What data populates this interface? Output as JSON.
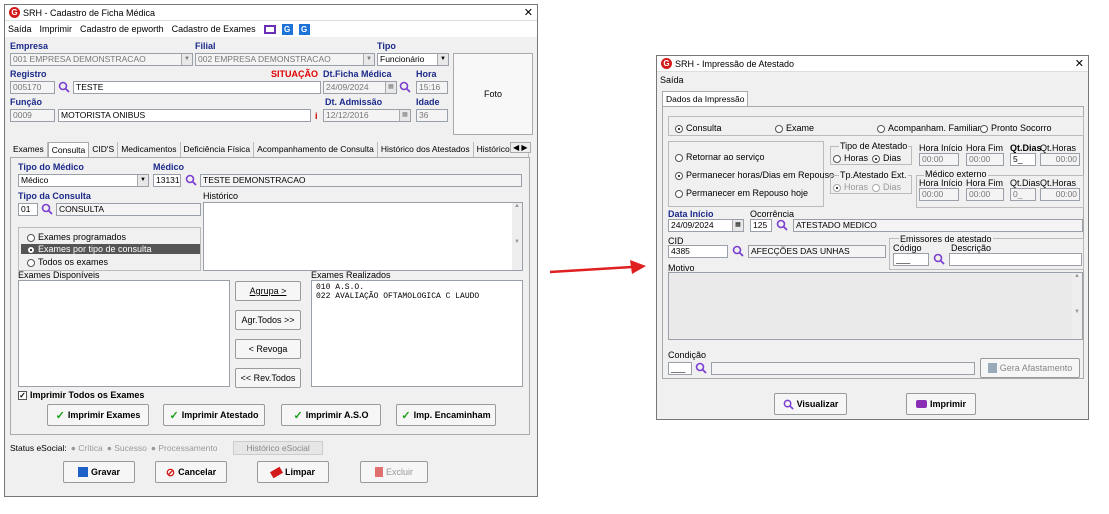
{
  "left_window": {
    "title": "SRH - Cadastro de Ficha Médica",
    "menu": [
      "Saída",
      "Imprimir",
      "Cadastro de epworth",
      "Cadastro de Exames"
    ],
    "empresa_label": "Empresa",
    "empresa_value": "001 EMPRESA DEMONSTRACAO",
    "filial_label": "Filial",
    "filial_value": "002 EMPRESA DEMONSTRACAO",
    "tipo_label": "Tipo",
    "tipo_value": "Funcionário",
    "registro_label": "Registro",
    "registro_code": "005170",
    "registro_name": "TESTE",
    "situacao_label": "SITUAÇÃO",
    "dt_ficha_label": "Dt.Ficha Médica",
    "dt_ficha_value": "24/09/2024",
    "hora_label": "Hora",
    "hora_value": "15:16",
    "foto_label": "Foto",
    "funcao_label": "Função",
    "funcao_code": "0009",
    "funcao_name": "MOTORISTA ONIBUS",
    "dt_admissao_label": "Dt. Admissão",
    "dt_admissao_value": "12/12/2016",
    "idade_label": "Idade",
    "idade_value": "36",
    "tabs": [
      "Exames",
      "Consulta",
      "CID'S",
      "Medicamentos",
      "Deficiência Física",
      "Acompanhamento de Consulta",
      "Histórico dos Atestados",
      "Histórico A.S"
    ],
    "tipo_medico_label": "Tipo do Médico",
    "tipo_medico_value": "Médico",
    "medico_label": "Médico",
    "medico_code": "13131",
    "medico_name": "TESTE DEMONSTRACAO",
    "tipo_consulta_label": "Tipo da Consulta",
    "tipo_consulta_code": "01",
    "tipo_consulta_name": "CONSULTA",
    "historico_label": "Histórico",
    "radio_options": [
      "Exames programados",
      "Exames por tipo de consulta",
      "Todos os exames"
    ],
    "exames_disponiveis_label": "Exames Disponíveis",
    "exames_realizados_label": "Exames Realizados",
    "exames_realizados": [
      "010 A.S.O.",
      "022 AVALIAÇÃO OFTAMOLOGICA C LAUDO"
    ],
    "btn_agrupa": "Agrupa >",
    "btn_agr_todos": "Agr.Todos >>",
    "btn_revoga": "< Revoga",
    "btn_rev_todos": "<< Rev.Todos",
    "imprimir_todos_label": "Imprimir Todos os Exames",
    "btn_imprimir_exames": "Imprimir Exames",
    "btn_imprimir_atestado": "Imprimir Atestado",
    "btn_imprimir_aso": "Imprimir A.S.O",
    "btn_imp_encaminham": "Imp. Encaminham",
    "status_label": "Status eSocial:",
    "status_critica": "Crítica",
    "status_sucesso": "Sucesso",
    "status_processamento": "Processamento",
    "historico_esocial": "Histórico eSocial",
    "btn_gravar": "Gravar",
    "btn_cancelar": "Cancelar",
    "btn_limpar": "Limpar",
    "btn_excluir": "Excluir"
  },
  "right_window": {
    "title": "SRH - Impressão de Atestado",
    "menu": [
      "Saída"
    ],
    "tab": "Dados da Impressão",
    "radio_top": [
      "Consulta",
      "Exame",
      "Acompanham. Familiar",
      "Pronto Socorro"
    ],
    "radio_left": [
      "Retornar ao serviço",
      "Permanecer  horas/Dias em Repouso",
      "Permanecer em Repouso hoje"
    ],
    "tipo_atestado_label": "Tipo de Atestado",
    "horas_label": "Horas",
    "dias_label": "Dias",
    "hora_inicio_label": "Hora Início",
    "hora_fim_label": "Hora Fim",
    "qt_dias_label": "Qt.Dias",
    "qt_horas_label": "Qt.Horas",
    "hora_inicio_value": "00:00",
    "hora_fim_value": "00:00",
    "qt_dias_value": "5_",
    "qt_horas_value": "00:00",
    "tp_atestado_ext_label": "Tp.Atestado Ext.",
    "medico_externo_label": "Médico externo",
    "ext_hora_inicio": "00:00",
    "ext_hora_fim": "00:00",
    "ext_qt_dias": "0_",
    "ext_qt_horas": "00:00",
    "data_inicio_label": "Data Início",
    "data_inicio_value": "24/09/2024",
    "ocorrencia_label": "Ocorrência",
    "ocorrencia_code": "125",
    "ocorrencia_name": "ATESTADO MEDICO",
    "cid_label": "CID",
    "cid_code": "4385",
    "cid_name": "AFECÇÕES DAS UNHAS",
    "emissores_label": "Emissores de atestado",
    "codigo_label": "Código",
    "descricao_label": "Descrição",
    "codigo_value": "___",
    "motivo_label": "Motivo",
    "condicao_label": "Condição",
    "condicao_value": "___",
    "btn_gera_afastamento": "Gera Afastamento",
    "btn_visualizar": "Visualizar",
    "btn_imprimir": "Imprimir"
  },
  "colors": {
    "label_blue": "#1c2a8a",
    "situacao_red": "#e30000",
    "arrow_red": "#e02020",
    "check_green": "#1aa01a"
  }
}
